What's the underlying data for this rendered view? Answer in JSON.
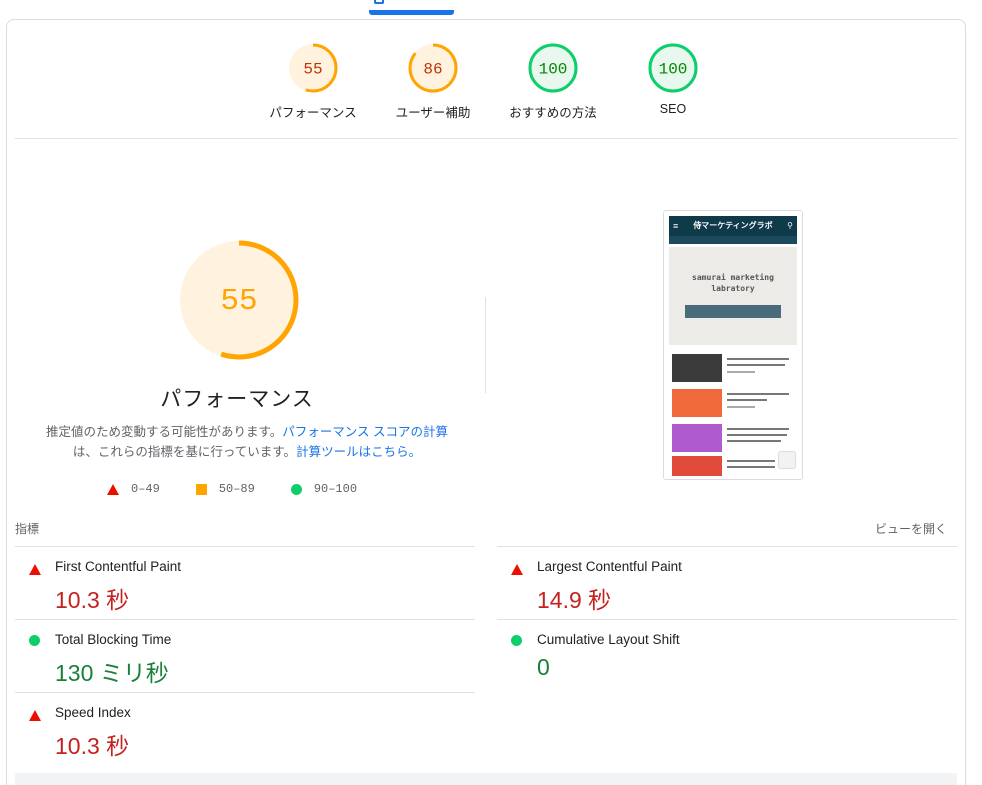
{
  "colors": {
    "red": "#eb0f00",
    "orange": "#ffa400",
    "green": "#0cce6b",
    "link": "#1a73e8"
  },
  "summary": [
    {
      "score": "55",
      "label": "パフォーマンス",
      "status": "average"
    },
    {
      "score": "86",
      "label": "ユーザー補助",
      "status": "average"
    },
    {
      "score": "100",
      "label": "おすすめの方法",
      "status": "pass"
    },
    {
      "score": "100",
      "label": "SEO",
      "status": "pass"
    }
  ],
  "performance": {
    "score": "55",
    "title": "パフォーマンス",
    "note_1": "推定値のため変動する可能性があります。",
    "note_link_1": "パフォーマンス スコアの計算",
    "note_2": "は、これらの指標を基に行っています。",
    "note_link_2": "計算ツールはこちら。"
  },
  "legend": [
    {
      "range": "0–49",
      "icon": "red-triangle-icon"
    },
    {
      "range": "50–89",
      "icon": "orange-square-icon"
    },
    {
      "range": "90–100",
      "icon": "green-circle-icon"
    }
  ],
  "screenshot": {
    "site_title": "侍マーケティングラボ",
    "hero_text_1": "samurai marketing",
    "hero_text_2": "labratory"
  },
  "metrics_header": {
    "label": "指標",
    "view_toggle": "ビューを開く"
  },
  "metrics": [
    {
      "name": "First Contentful Paint",
      "value": "10.3 秒",
      "status": "fail"
    },
    {
      "name": "Largest Contentful Paint",
      "value": "14.9 秒",
      "status": "fail"
    },
    {
      "name": "Total Blocking Time",
      "value": "130 ミリ秒",
      "status": "pass"
    },
    {
      "name": "Cumulative Layout Shift",
      "value": "0",
      "status": "pass"
    },
    {
      "name": "Speed Index",
      "value": "10.3 秒",
      "status": "fail"
    }
  ]
}
